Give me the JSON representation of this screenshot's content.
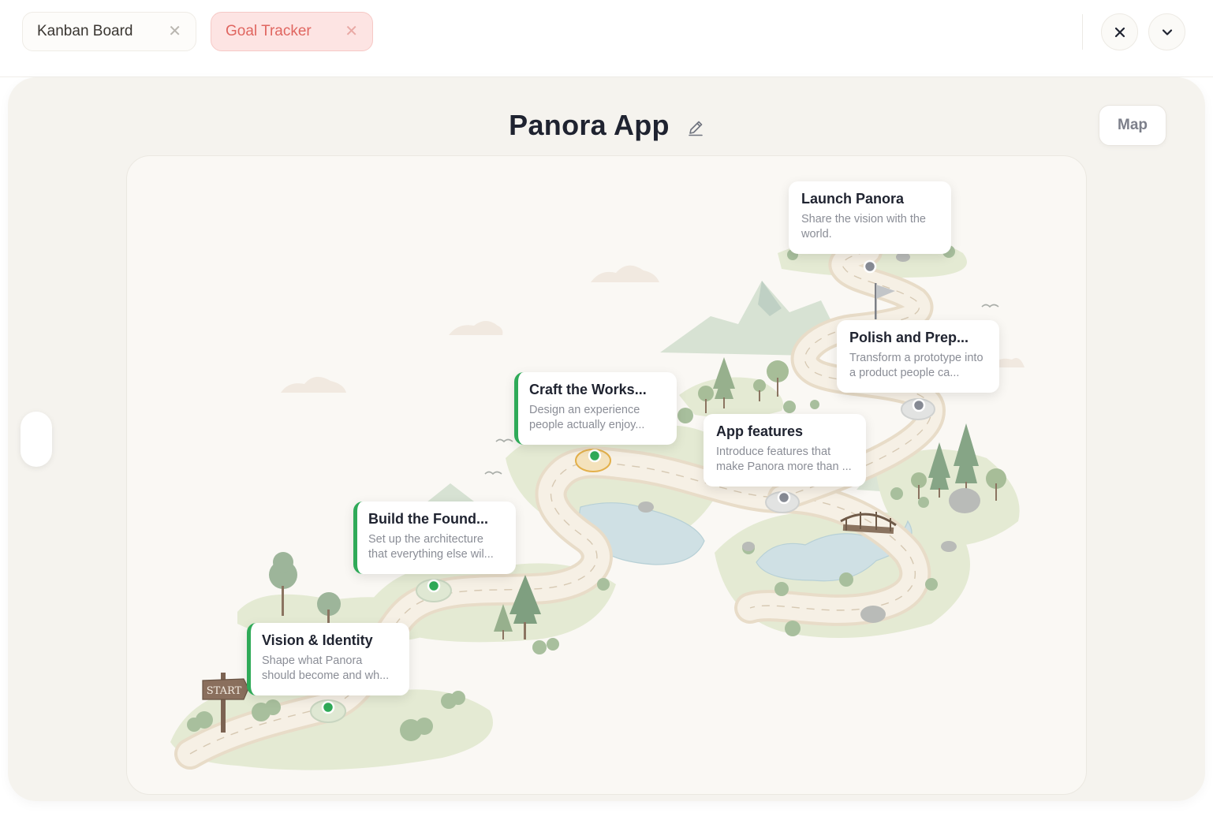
{
  "tabs": [
    {
      "label": "Kanban Board",
      "active": false
    },
    {
      "label": "Goal Tracker",
      "active": true
    }
  ],
  "header": {
    "title": "Panora App",
    "map_button": "Map"
  },
  "map": {
    "start_sign": "START",
    "milestones": [
      {
        "title": "Vision & Identity",
        "description": "Shape what Panora should become and wh...",
        "status": "done"
      },
      {
        "title": "Build the Found...",
        "description": "Set up the architecture that everything else wil...",
        "status": "done"
      },
      {
        "title": "Craft the Works...",
        "description": "Design an experience people actually enjoy...",
        "status": "in-progress"
      },
      {
        "title": "App features",
        "description": "Introduce features that make Panora more than ...",
        "status": "pending"
      },
      {
        "title": "Polish and Prep...",
        "description": "Transform a prototype into a product people ca...",
        "status": "pending"
      },
      {
        "title": "Launch Panora",
        "description": "Share the vision with the world.",
        "status": "pending"
      }
    ]
  },
  "colors": {
    "accent_red": "#e06660",
    "done_green": "#2faa58",
    "progress_gold": "#e3b04b",
    "pending_gray": "#868a94"
  },
  "icons": [
    "close-icon",
    "chevron-down-icon",
    "pencil-icon"
  ]
}
